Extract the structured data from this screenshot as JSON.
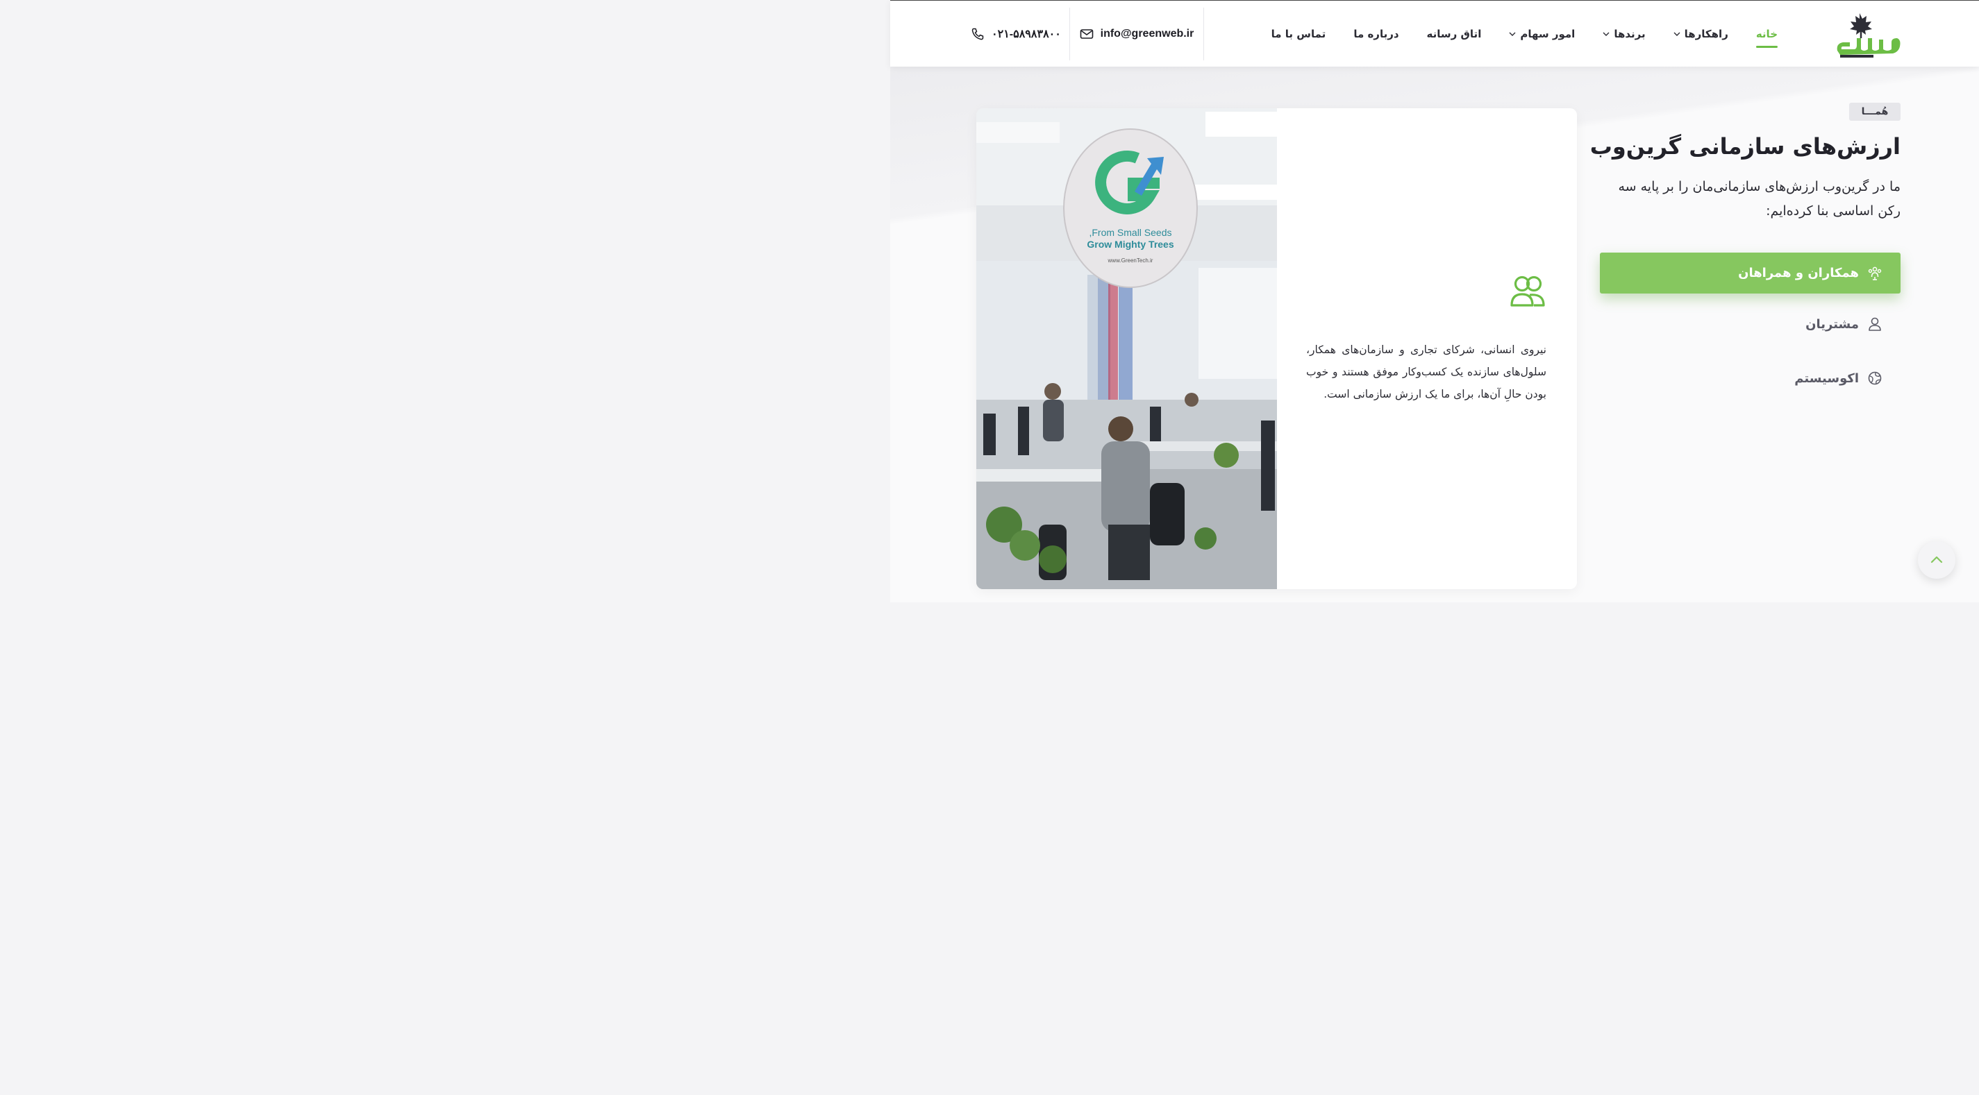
{
  "brand": {
    "logo_alt": "گرین‌وب",
    "logo_icon": "maple-leaf-icon",
    "color_primary": "#6cbd45",
    "color_dark": "#2d2d36"
  },
  "nav": {
    "items": [
      {
        "label": "خانه",
        "active": true,
        "has_dropdown": false
      },
      {
        "label": "راهکارها",
        "active": false,
        "has_dropdown": true
      },
      {
        "label": "برندها",
        "active": false,
        "has_dropdown": true
      },
      {
        "label": "امور سهام",
        "active": false,
        "has_dropdown": true
      },
      {
        "label": "اتاق رسانه",
        "active": false,
        "has_dropdown": false
      },
      {
        "label": "درباره ما",
        "active": false,
        "has_dropdown": false
      },
      {
        "label": "تماس با ما",
        "active": false,
        "has_dropdown": false
      }
    ]
  },
  "contact": {
    "email": "info@greenweb.ir",
    "email_icon": "mail-icon",
    "phone": "۰۲۱-۵۸۹۸۳۸۰۰",
    "phone_icon": "phone-icon"
  },
  "values": {
    "badge": "هُمـــا",
    "heading": "ارزش‌های سازمانی گرین‌وب",
    "lead": "ما در گرین‌وب ارزش‌های سازمانی‌مان را بر پایه سه رکن اساسی بنا کرده‌ایم:",
    "tabs": [
      {
        "label": "همکاران و همراهان",
        "icon": "team-icon",
        "active": true
      },
      {
        "label": "مشتریان",
        "icon": "user-icon",
        "active": false
      },
      {
        "label": "اکوسیستم",
        "icon": "globe-icon",
        "active": false
      }
    ],
    "card": {
      "icon": "users-icon",
      "text": "نیروی انسانی، شرکای تجاری و سازمان‌های همکار، سلول‌های سازنده یک کسب‌وکار موفق هستند و خوب بودن حالِ آن‌ها، برای ما یک ارزش سازمانی است.",
      "photo_sign_line1": "From Small Seeds,",
      "photo_sign_line2": "Grow Mighty Trees",
      "photo_sign_url": "www.GreenTech.ir"
    }
  },
  "scroll_top": {
    "icon": "chevron-up-icon"
  }
}
